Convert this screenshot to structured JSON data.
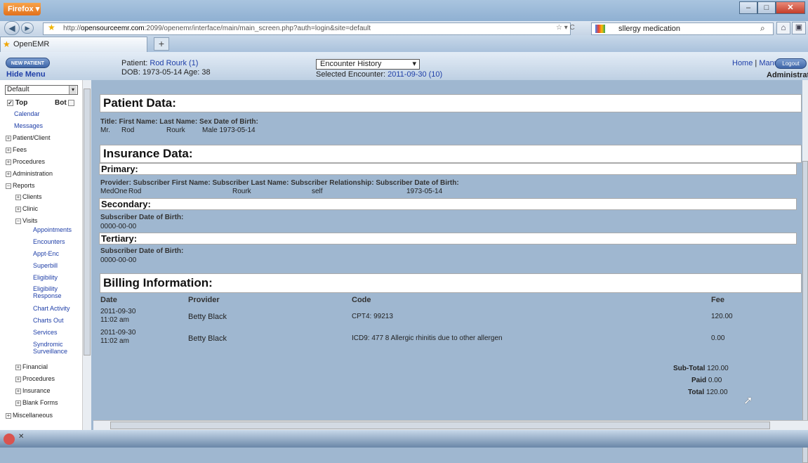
{
  "browser": {
    "app_button": "Firefox",
    "url_host": "opensourceemr.com",
    "url_prefix": "http://",
    "url_path": ":2099/openemr/interface/main/main_screen.php?auth=login&site=default",
    "search_value": "sllergy medication",
    "tab_title": "OpenEMR",
    "new_tab": "+"
  },
  "header": {
    "new_patient": "NEW PATIENT",
    "hide_menu": "Hide Menu",
    "patient_label": "Patient:",
    "patient_name": "Rod Rourk (1)",
    "dob_line": "DOB: 1973-05-14 Age: 38",
    "encounter_select": "Encounter History",
    "selected_encounter_label": "Selected Encounter:",
    "selected_encounter": "2011-09-30 (10)",
    "home": "Home",
    "sep": "|",
    "manual": "Manual",
    "logout": "Logout",
    "user": "Administrator"
  },
  "menu": {
    "default_select": "Default",
    "top": "Top",
    "bot": "Bot",
    "items": [
      "Calendar",
      "Messages",
      "Patient/Client",
      "Fees",
      "Procedures",
      "Administration",
      "Reports",
      "Clients",
      "Clinic",
      "Visits",
      "Appointments",
      "Encounters",
      "Appt-Enc",
      "Superbill",
      "Eligibility",
      "Eligibility Response",
      "Chart Activity",
      "Charts Out",
      "Services",
      "Syndromic Surveillance",
      "Financial",
      "Procedures",
      "Insurance",
      "Blank Forms",
      "Miscellaneous"
    ]
  },
  "patient_data": {
    "heading": "Patient Data:",
    "labels": "Title: First Name: Last Name: Sex Date of Birth:",
    "title": "Mr.",
    "first": "Rod",
    "last": "Rourk",
    "sex_dob": "Male 1973-05-14"
  },
  "insurance": {
    "heading": "Insurance Data:",
    "primary": "Primary:",
    "primary_labels": "Provider: Subscriber First Name: Subscriber Last Name: Subscriber Relationship: Subscriber Date of Birth:",
    "provider": "MedOne",
    "sub_first": "Rod",
    "sub_last": "Rourk",
    "relationship": "self",
    "sub_dob": "1973-05-14",
    "secondary": "Secondary:",
    "sec_label": "Subscriber Date of Birth:",
    "sec_dob": "0000-00-00",
    "tertiary": "Tertiary:",
    "ter_label": "Subscriber Date of Birth:",
    "ter_dob": "0000-00-00"
  },
  "billing": {
    "heading": "Billing Information:",
    "columns": [
      "Date",
      "Provider",
      "Code",
      "Fee"
    ],
    "rows": [
      {
        "date1": "2011-09-30",
        "date2": "11:02 am",
        "provider": "Betty Black",
        "code": "CPT4: 99213",
        "fee": "120.00"
      },
      {
        "date1": "2011-09-30",
        "date2": "11:02 am",
        "provider": "Betty Black",
        "code": "ICD9: 477 8  Allergic rhinitis due to other allergen",
        "fee": "0.00"
      }
    ],
    "subtotal_label": "Sub-Total",
    "subtotal": "120.00",
    "paid_label": "Paid",
    "paid": "0.00",
    "total_label": "Total",
    "total": "120.00"
  }
}
